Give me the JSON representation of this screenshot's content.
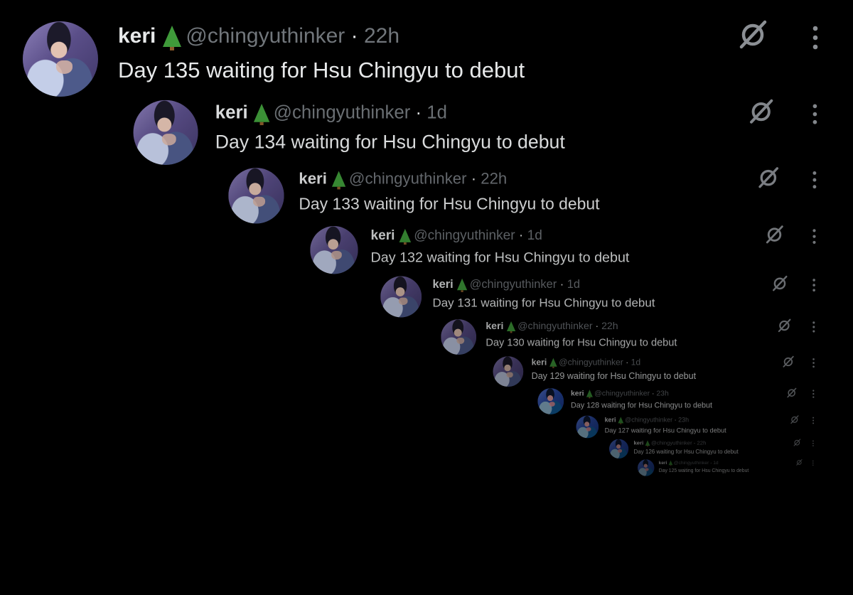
{
  "tweets": [
    {
      "name": "keri",
      "handle": "@chingyuthinker",
      "time": "22h",
      "text": "Day 135 waiting for Hsu Chingyu to debut"
    },
    {
      "name": "keri",
      "handle": "@chingyuthinker",
      "time": "1d",
      "text": "Day 134 waiting for Hsu Chingyu to debut"
    },
    {
      "name": "keri",
      "handle": "@chingyuthinker",
      "time": "22h",
      "text": "Day 133 waiting for Hsu Chingyu to debut"
    },
    {
      "name": "keri",
      "handle": "@chingyuthinker",
      "time": "1d",
      "text": "Day 132 waiting for Hsu Chingyu to debut"
    },
    {
      "name": "keri",
      "handle": "@chingyuthinker",
      "time": "1d",
      "text": "Day 131 waiting for Hsu Chingyu to debut"
    },
    {
      "name": "keri",
      "handle": "@chingyuthinker",
      "time": "22h",
      "text": "Day 130 waiting for Hsu Chingyu to debut"
    },
    {
      "name": "keri",
      "handle": "@chingyuthinker",
      "time": "1d",
      "text": "Day 129 waiting for Hsu Chingyu to debut"
    },
    {
      "name": "keri",
      "handle": "@chingyuthinker",
      "time": "23h",
      "text": "Day 128 waiting for Hsu Chingyu to debut"
    },
    {
      "name": "keri",
      "handle": "@chingyuthinker",
      "time": "23h",
      "text": "Day 127 waiting for Hsu Chingyu to debut"
    },
    {
      "name": "keri",
      "handle": "@chingyuthinker",
      "time": "22h",
      "text": "Day 126 waiting for Hsu Chingyu to debut"
    },
    {
      "name": "keri",
      "handle": "@chingyuthinker",
      "time": "1d",
      "text": "Day 125 waiting for Hsu Chingyu to debut"
    }
  ],
  "icons": {
    "grok": "grok-icon",
    "more": "more-icon",
    "emoji": "christmas-tree-emoji"
  }
}
